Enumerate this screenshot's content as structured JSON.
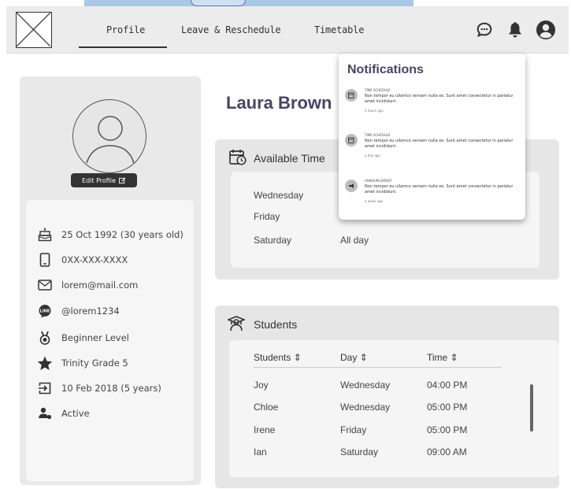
{
  "nav": {
    "profile_label": "Profile",
    "leave_label": "Leave & Reschedule",
    "timetable_label": "Timetable"
  },
  "profile": {
    "name": "Laura Brown",
    "edit_label": "Edit Profile",
    "dob": "25 Oct 1992 (30 years old)",
    "phone": "0XX-XXX-XXXX",
    "email": "lorem@mail.com",
    "line_id": "@lorem1234",
    "level": "Beginner Level",
    "grade": "Trinity Grade 5",
    "joined": "10 Feb 2018 (5 years)",
    "status": "Active"
  },
  "available_time": {
    "heading": "Available Time",
    "rows": [
      {
        "day": "Wednesday",
        "time": ""
      },
      {
        "day": "Friday",
        "time": ""
      },
      {
        "day": "Saturday",
        "time": "All day"
      }
    ]
  },
  "students": {
    "heading": "Students",
    "headers": [
      "Students",
      "Day",
      "Time"
    ],
    "rows": [
      {
        "name": "Joy",
        "day": "Wednesday",
        "time": "04:00 PM"
      },
      {
        "name": "Chloe",
        "day": "Wednesday",
        "time": "05:00 PM"
      },
      {
        "name": "Irene",
        "day": "Friday",
        "time": "05:00 PM"
      },
      {
        "name": "Ian",
        "day": "Saturday",
        "time": "09:00 AM"
      }
    ]
  },
  "notifications": {
    "title": "Notifications",
    "items": [
      {
        "tag": "TIME SCHEDULE",
        "body": "Non tempor eu ullamco veniam nulla ex. Sunt amet consectetur in pariatur amet incididunt.",
        "time": "2 hours ago"
      },
      {
        "tag": "TIME SCHEDULE",
        "body": "Non tempor eu ullamco veniam nulla ex. Sunt amet consectetur in pariatur amet incididunt.",
        "time": "a day ago"
      },
      {
        "tag": "ANNOUNCEMENT",
        "body": "Non tempor eu ullamco veniam nulla ex. Sunt amet consectetur in pariatur amet incididunt.",
        "time": "a week ago"
      }
    ]
  }
}
